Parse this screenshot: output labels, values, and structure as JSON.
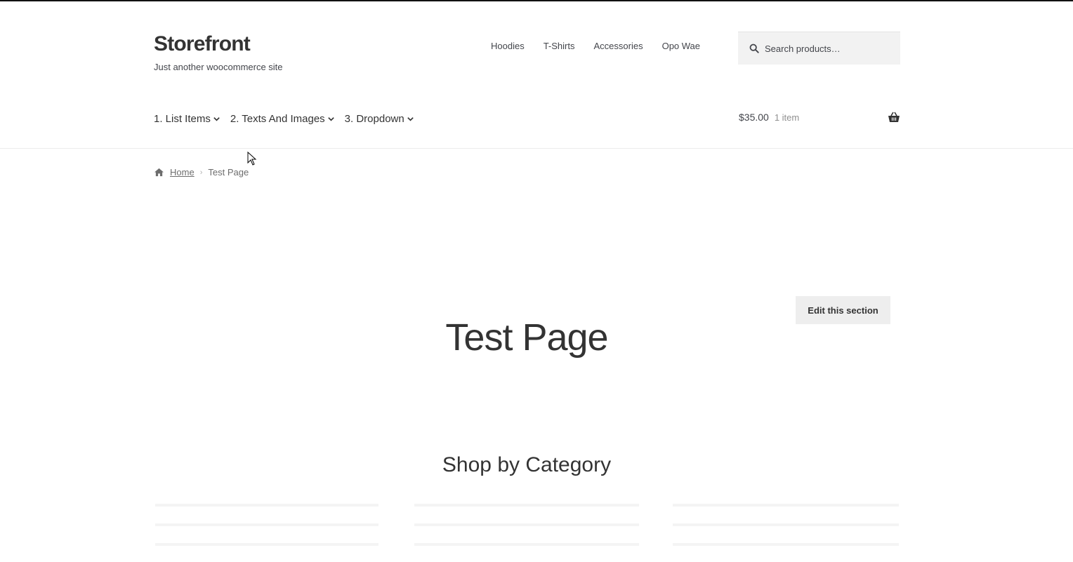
{
  "header": {
    "site_title": "Storefront",
    "tagline": "Just another woocommerce site"
  },
  "secondary_nav": {
    "items": [
      {
        "label": "Hoodies"
      },
      {
        "label": "T-Shirts"
      },
      {
        "label": "Accessories"
      },
      {
        "label": "Opo Wae"
      }
    ]
  },
  "search": {
    "placeholder": "Search products…",
    "icon": "search-icon"
  },
  "primary_nav": {
    "items": [
      {
        "label": "1. List Items"
      },
      {
        "label": "2. Texts And Images"
      },
      {
        "label": "3. Dropdown"
      }
    ]
  },
  "cart": {
    "amount": "$35.00",
    "count": "1 item",
    "icon": "basket-icon"
  },
  "breadcrumb": {
    "home": "Home",
    "current": "Test Page"
  },
  "main": {
    "edit_button": "Edit this section",
    "page_title": "Test Page",
    "section_title": "Shop by Category"
  },
  "colors": {
    "text": "#43454b",
    "heading": "#333333",
    "search_bg": "#f2f2f2",
    "button_bg": "#eeeeee"
  }
}
